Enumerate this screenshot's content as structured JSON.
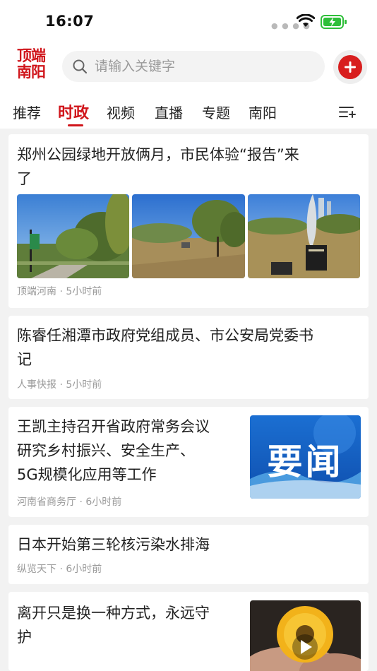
{
  "status_bar": {
    "time": "16:07"
  },
  "header": {
    "logo_line1": "顶端",
    "logo_line2": "南阳",
    "search_placeholder": "请输入关键字"
  },
  "tabs": [
    {
      "label": "推荐",
      "active": false
    },
    {
      "label": "时政",
      "active": true
    },
    {
      "label": "视频",
      "active": false
    },
    {
      "label": "直播",
      "active": false
    },
    {
      "label": "专题",
      "active": false
    },
    {
      "label": "南阳",
      "active": false
    }
  ],
  "feed": [
    {
      "title_line1": "郑州公园绿地开放俩月，市民体验“报告”来",
      "title_line2": "了",
      "source": "顶端河南",
      "time": "5小时前",
      "image_count": 3
    },
    {
      "title_line1": "陈睿任湘潭市政府党组成员、市公安局党委书",
      "title_line2": "记",
      "source": "人事快报",
      "time": "5小时前"
    },
    {
      "title_line1": "王凯主持召开省政府常务会议",
      "title_line2": "研究乡村振兴、安全生产、",
      "title_line3": "5G规模化应用等工作",
      "source": "河南省商务厅",
      "time": "6小时前",
      "thumb_text": "要闻"
    },
    {
      "title_line1": "日本开始第三轮核污染水排海",
      "source": "纵览天下",
      "time": "6小时前"
    },
    {
      "title_line1": "离开只是换一种方式，永远守",
      "title_line2": "护",
      "has_video": true
    }
  ],
  "colors": {
    "brand_red": "#d0151b",
    "add_button": "#d81e1e",
    "meta_grey": "#9a9a9a"
  }
}
